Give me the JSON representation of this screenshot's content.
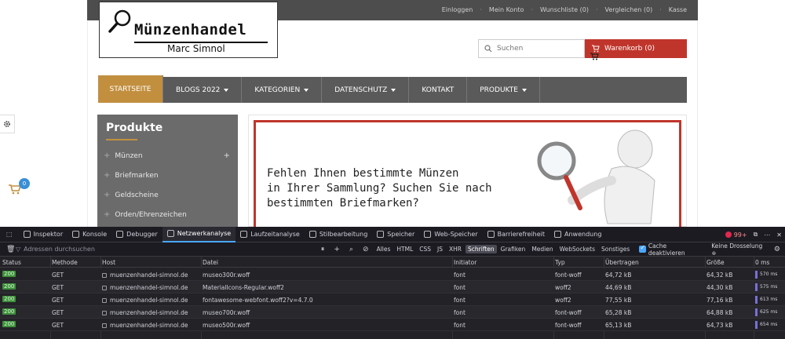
{
  "site": {
    "top_links": [
      "Einloggen",
      "Mein Konto",
      "Wunschliste (0)",
      "Vergleichen (0)",
      "Kasse"
    ],
    "logo": {
      "title": "Münzenhandel",
      "subtitle": "Marc Simnol"
    },
    "search": {
      "placeholder": "Suchen"
    },
    "cart": {
      "label": "Warenkorb (0)"
    },
    "nav": [
      {
        "label": "STARTSEITE",
        "dropdown": false,
        "active": true
      },
      {
        "label": "BLOGS 2022",
        "dropdown": true
      },
      {
        "label": "KATEGORIEN",
        "dropdown": true
      },
      {
        "label": "DATENSCHUTZ",
        "dropdown": true
      },
      {
        "label": "KONTAKT",
        "dropdown": false
      },
      {
        "label": "PRODUKTE",
        "dropdown": true
      }
    ],
    "sidebar": {
      "title": "Produkte",
      "items": [
        "Münzen",
        "Briefmarken",
        "Geldscheine",
        "Orden/Ehrenzeichen"
      ]
    },
    "banner": {
      "lines": [
        "Fehlen Ihnen bestimmte Münzen",
        "in Ihrer Sammlung? Suchen Sie nach",
        "bestimmten Briefmarken?"
      ]
    },
    "floating_cart_count": "0"
  },
  "devtools": {
    "tabs": [
      "Inspektor",
      "Konsole",
      "Debugger",
      "Netzwerkanalyse",
      "Laufzeitanalyse",
      "Stilbearbeitung",
      "Speicher",
      "Web-Speicher",
      "Barrierefreiheit",
      "Anwendung"
    ],
    "active_tab": "Netzwerkanalyse",
    "error_count": "99+",
    "filter_placeholder": "Adressen durchsuchen",
    "filter_types": [
      "Alles",
      "HTML",
      "CSS",
      "JS",
      "XHR",
      "Schriften",
      "Grafiken",
      "Medien",
      "WebSockets",
      "Sonstiges"
    ],
    "active_filter": "Schriften",
    "disable_cache_label": "Cache deaktivieren",
    "throttling": "Keine Drosselung ≑",
    "columns": [
      "Status",
      "Methode",
      "Host",
      "Datei",
      "Initiator",
      "Typ",
      "Übertragen",
      "Größe",
      "0 ms"
    ],
    "rows": [
      {
        "status": "200",
        "method": "GET",
        "host": "muenzenhandel-simnol.de",
        "file": "museo300r.woff",
        "initiator": "font",
        "type": "font-woff",
        "transferred": "64,72 kB",
        "size": "64,32 kB",
        "time": "570 ms"
      },
      {
        "status": "200",
        "method": "GET",
        "host": "muenzenhandel-simnol.de",
        "file": "MaterialIcons-Regular.woff2",
        "initiator": "font",
        "type": "woff2",
        "transferred": "44,69 kB",
        "size": "44,30 kB",
        "time": "575 ms"
      },
      {
        "status": "200",
        "method": "GET",
        "host": "muenzenhandel-simnol.de",
        "file": "fontawesome-webfont.woff2?v=4.7.0",
        "initiator": "font",
        "type": "woff2",
        "transferred": "77,55 kB",
        "size": "77,16 kB",
        "time": "613 ms"
      },
      {
        "status": "200",
        "method": "GET",
        "host": "muenzenhandel-simnol.de",
        "file": "museo700r.woff",
        "initiator": "font",
        "type": "font-woff",
        "transferred": "65,28 kB",
        "size": "64,88 kB",
        "time": "625 ms"
      },
      {
        "status": "200",
        "method": "GET",
        "host": "muenzenhandel-simnol.de",
        "file": "museo500r.woff",
        "initiator": "font",
        "type": "font-woff",
        "transferred": "65,13 kB",
        "size": "64,73 kB",
        "time": "654 ms"
      }
    ]
  }
}
